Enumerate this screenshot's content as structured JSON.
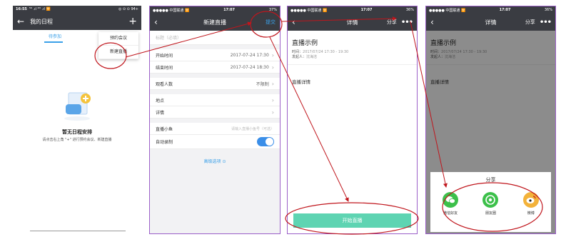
{
  "colors": {
    "accent": "#3aa0e8",
    "nav": "#3a3c42",
    "start": "#5ed4b2",
    "annotation": "#c0161d",
    "frame": "#9b5fc8"
  },
  "p1": {
    "status_time": "16:55",
    "status_left_extra": "⁵⁶ .ıl ⁴ᴳ .ıl 🛜",
    "status_right": "◎ ⊙ ⊙ 94+",
    "title": "我的日程",
    "add": "+",
    "tab": "待参加",
    "menu": [
      "预约会议",
      "新建直播"
    ],
    "empty_title": "暂无日程安排",
    "empty_sub": "请点击右上角 \"+\" 进行预约会议、新建直播"
  },
  "p2": {
    "status_carrier": "●●●●● 中国联通 🛜",
    "status_time": "17:07",
    "status_battery": "37%",
    "title": "新建直播",
    "submit": "提交",
    "title_placeholder": "标题（必填）",
    "start_label": "开始时间",
    "start_value": "2017-07-24 17:30",
    "end_label": "结束时间",
    "end_value": "2017-07-24 18:30",
    "viewers_label": "观看人数",
    "viewers_value": "不限制",
    "location_label": "地点",
    "details_label": "详情",
    "room_label": "直播小鱼",
    "room_placeholder": "请输入直播小鱼号（可选）",
    "autorec_label": "自动录制",
    "advanced": "高级选项 ⊙"
  },
  "p3": {
    "status_carrier": "●●●●● 中国联通 🛜",
    "status_time": "17:07",
    "status_battery": "36%",
    "title": "详情",
    "share": "分享",
    "more": "•••",
    "heading": "直播示例",
    "time_label": "时间：",
    "time_value": "2017/07/24 17:30 - 19:30",
    "host_label": "发起人：",
    "host_value": "沈海洁",
    "detail": "直播详情",
    "start": "开始直播"
  },
  "p4": {
    "status_carrier": "●●●●● 中国联通 🛜",
    "status_time": "17:07",
    "status_battery": "36%",
    "title": "详情",
    "share": "分享",
    "more": "•••",
    "heading": "直播示例",
    "time_label": "时间：",
    "time_value": "2017/07/24 17:30 - 19:30",
    "host_label": "发起人：",
    "host_value": "沈海洁",
    "detail": "直播详情",
    "sheet_title": "分享",
    "wechat": "微信好友",
    "moments": "朋友圈",
    "weibo": "微博"
  }
}
